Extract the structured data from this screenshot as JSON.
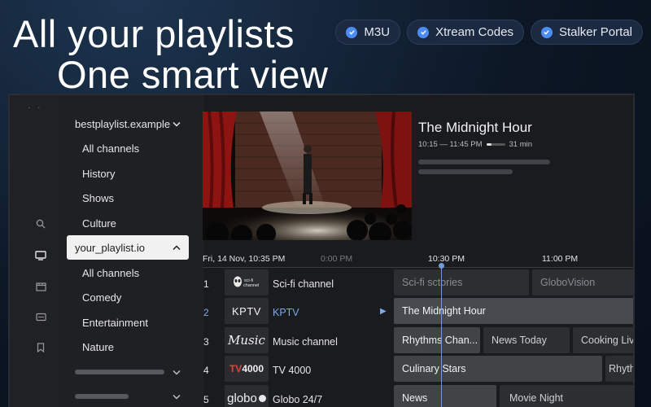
{
  "hero": {
    "line1": "All your playlists",
    "line2": "One smart view"
  },
  "chips": [
    {
      "label": "M3U",
      "icon": "check-icon"
    },
    {
      "label": "Xtream Codes",
      "icon": "check-icon"
    },
    {
      "label": "Stalker Portal",
      "icon": "check-icon"
    }
  ],
  "rail": {
    "icons": [
      "search-icon",
      "tv-icon",
      "movie-icon",
      "series-icon",
      "bookmark-icon"
    ]
  },
  "sidebar": {
    "groups": [
      {
        "label": "bestplaylist.example",
        "expanded": true
      },
      {
        "label": "your_playlist.io",
        "expanded": true
      }
    ],
    "group1_items": [
      "All channels",
      "History",
      "Shows",
      "Culture"
    ],
    "group2_items": [
      "All channels",
      "Comedy",
      "Entertainment",
      "Nature"
    ]
  },
  "now_playing": {
    "title": "The Midnight Hour",
    "time_range": "10:15 — 11:45 PM",
    "remaining": "31 min",
    "progress": 0.3
  },
  "epg": {
    "date": "Fri,  14 Nov, 10:35 PM",
    "ticks": [
      "0:00 PM",
      "10:30 PM",
      "11:00 PM"
    ],
    "channels": [
      {
        "num": "1",
        "logo": "Sci-fi channel",
        "name": "Sci-fi channel",
        "programs": [
          "Sci-fi sctories",
          "GloboVision"
        ]
      },
      {
        "num": "2",
        "logo": "KPTV",
        "name": "KPTV",
        "selected": true,
        "programs": [
          "The Midnight Hour"
        ]
      },
      {
        "num": "3",
        "logo": "Music",
        "name": "Music channel",
        "programs": [
          "Rhythms Chan...",
          "News Today",
          "Cooking Live"
        ]
      },
      {
        "num": "4",
        "logo": "TV4000",
        "name": "TV 4000",
        "programs": [
          "Culinary Stars",
          "Rhythm"
        ]
      },
      {
        "num": "5",
        "logo": "globo",
        "name": "Globo 24/7",
        "programs": [
          "News",
          "Movie Night"
        ]
      }
    ]
  },
  "colors": {
    "accent": "#4d8cf5",
    "selected_text": "#7fa8e4",
    "background": "#0c1624"
  }
}
